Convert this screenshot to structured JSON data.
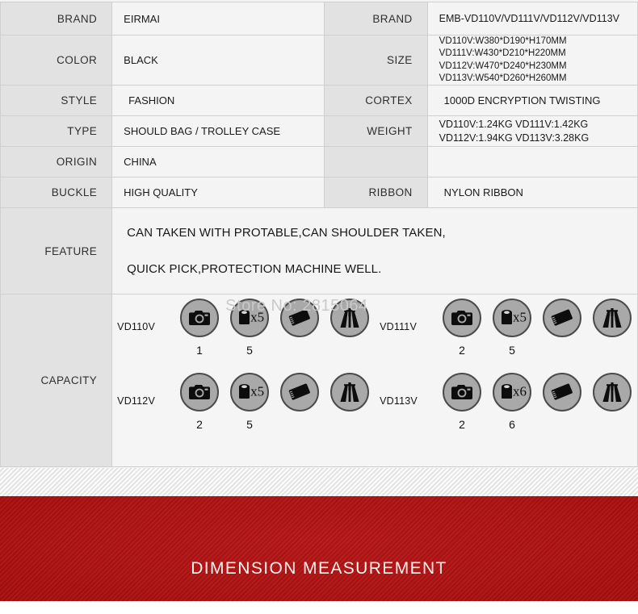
{
  "spec": {
    "rows": [
      {
        "left_label": "BRAND",
        "left_value": "EIRMAI",
        "right_label": "BRAND",
        "right_value": "EMB-VD110V/VD111V/VD112V/VD113V"
      },
      {
        "left_label": "COLOR",
        "left_value": "BLACK",
        "right_label": "SIZE",
        "right_value": "VD110V:W380*D190*H170MM\nVD111V:W430*D210*H220MM\nVD112V:W470*D240*H230MM\nVD113V:W540*D260*H260MM"
      },
      {
        "left_label": "STYLE",
        "left_value": "FASHION",
        "right_label": "CORTEX",
        "right_value": "1000D  ENCRYPTION TWISTING"
      },
      {
        "left_label": "TYPE",
        "left_value": "SHOULD BAG / TROLLEY CASE",
        "right_label": "WEIGHT",
        "right_value": "VD110V:1.24KG  VD111V:1.42KG\nVD112V:1.94KG  VD113V:3.28KG"
      },
      {
        "left_label": "ORIGIN",
        "left_value": "CHINA",
        "right_label": "",
        "right_value": ""
      },
      {
        "left_label": "BUCKLE",
        "left_value": "HIGH QUALITY",
        "right_label": "RIBBON",
        "right_value": "NYLON RIBBON"
      }
    ],
    "feature": {
      "label": "FEATURE",
      "line1": "CAN TAKEN WITH PROTABLE,CAN SHOULDER TAKEN,",
      "line2": "QUICK PICK,PROTECTION MACHINE WELL."
    },
    "capacity": {
      "label": "CAPACITY",
      "watermark": "Store No: 2815064",
      "groups": [
        {
          "model": "VD110V",
          "items": [
            {
              "icon": "camera-icon",
              "count": "1",
              "multiplier": ""
            },
            {
              "icon": "lens-icon",
              "count": "5",
              "multiplier": "x5"
            },
            {
              "icon": "flash-icon",
              "count": "",
              "multiplier": ""
            },
            {
              "icon": "tripod-icon",
              "count": "",
              "multiplier": ""
            }
          ]
        },
        {
          "model": "VD111V",
          "items": [
            {
              "icon": "camera-icon",
              "count": "2",
              "multiplier": ""
            },
            {
              "icon": "lens-icon",
              "count": "5",
              "multiplier": "x5"
            },
            {
              "icon": "flash-icon",
              "count": "",
              "multiplier": ""
            },
            {
              "icon": "tripod-icon",
              "count": "",
              "multiplier": ""
            }
          ]
        },
        {
          "model": "VD112V",
          "items": [
            {
              "icon": "camera-icon",
              "count": "2",
              "multiplier": ""
            },
            {
              "icon": "lens-icon",
              "count": "5",
              "multiplier": "x5"
            },
            {
              "icon": "flash-icon",
              "count": "",
              "multiplier": ""
            },
            {
              "icon": "tripod-icon",
              "count": "",
              "multiplier": ""
            }
          ]
        },
        {
          "model": "VD113V",
          "items": [
            {
              "icon": "camera-icon",
              "count": "2",
              "multiplier": ""
            },
            {
              "icon": "lens-icon",
              "count": "6",
              "multiplier": "x6"
            },
            {
              "icon": "flash-icon",
              "count": "",
              "multiplier": ""
            },
            {
              "icon": "tripod-icon",
              "count": "",
              "multiplier": ""
            }
          ]
        }
      ]
    }
  },
  "banner": {
    "title": "DIMENSION MEASUREMENT",
    "background_color": "#ad1111",
    "text_color": "#fdf2ee"
  }
}
